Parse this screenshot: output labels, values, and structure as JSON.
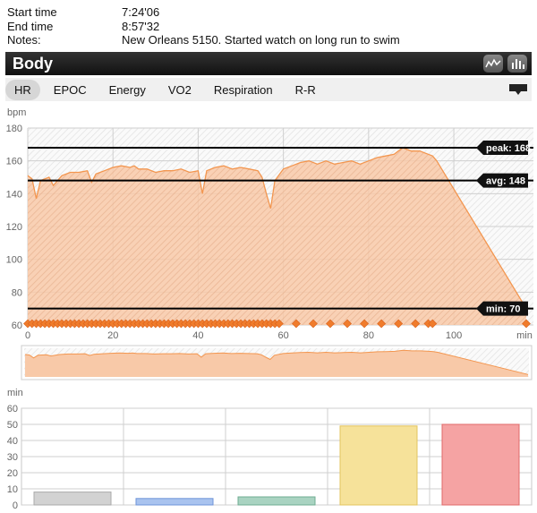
{
  "info": [
    {
      "label": "Start time",
      "value": "7:24'06"
    },
    {
      "label": "End time",
      "value": "8:57'32"
    },
    {
      "label": "Notes:",
      "value": "New Orleans 5150. Started watch on long run to swim"
    }
  ],
  "panel": {
    "title": "Body"
  },
  "tabs": [
    "HR",
    "EPOC",
    "Energy",
    "VO2",
    "Respiration",
    "R-R"
  ],
  "active_tab": "HR",
  "colors": {
    "hr_fill": "#f8c9a8",
    "hr_line": "#f3964f",
    "marker": "#f07c2c",
    "bar_gray": "#d2d2d2",
    "bar_blue": "#a9c3ef",
    "bar_green": "#a9d3c1",
    "bar_yellow": "#f6e29a",
    "bar_red": "#f5a3a3"
  },
  "icons": [
    "waveform-icon",
    "bars-icon",
    "dropdown-menu-icon"
  ],
  "chart_data": [
    {
      "type": "area",
      "ylabel": "bpm",
      "xlabel_unit": "min",
      "ylim": [
        60,
        180
      ],
      "xlim": [
        0,
        117
      ],
      "y_ticks": [
        "60",
        "80",
        "100",
        "120",
        "140",
        "160",
        "180"
      ],
      "x_ticks": [
        "0",
        "20",
        "40",
        "60",
        "80",
        "100"
      ],
      "x_unit_label": "min",
      "references": [
        {
          "label": "peak: 168",
          "value": 168
        },
        {
          "label": "avg: 148",
          "value": 148
        },
        {
          "label": "min: 70",
          "value": 70
        }
      ],
      "x": [
        0,
        1,
        2,
        3,
        5,
        6,
        8,
        10,
        12,
        14,
        15,
        16,
        18,
        20,
        22,
        24,
        25,
        26,
        28,
        30,
        32,
        34,
        36,
        38,
        40,
        41,
        42,
        44,
        46,
        48,
        50,
        52,
        54,
        55,
        56,
        57,
        58,
        60,
        62,
        64,
        66,
        68,
        70,
        72,
        74,
        76,
        78,
        80,
        82,
        84,
        86,
        88,
        90,
        92,
        94,
        95,
        96,
        117
      ],
      "values": [
        151,
        149,
        137,
        148,
        150,
        145,
        151,
        153,
        153,
        154,
        147,
        152,
        154,
        156,
        157,
        156,
        157,
        155,
        155,
        153,
        154,
        154,
        155,
        153,
        154,
        140,
        154,
        156,
        157,
        155,
        156,
        155,
        154,
        150,
        140,
        131,
        148,
        155,
        157,
        159,
        160,
        158,
        160,
        158,
        159,
        160,
        158,
        160,
        162,
        163,
        164,
        168,
        166,
        166,
        164,
        163,
        160,
        70
      ],
      "markers_x": [
        0,
        1,
        2,
        3,
        4,
        5,
        6,
        7,
        8,
        9,
        10,
        11,
        12,
        13,
        14,
        15,
        16,
        17,
        18,
        19,
        20,
        21,
        22,
        23,
        24,
        25,
        26,
        27,
        28,
        29,
        30,
        31,
        32,
        33,
        34,
        35,
        36,
        37,
        38,
        39,
        40,
        41,
        42,
        43,
        44,
        45,
        46,
        47,
        48,
        49,
        50,
        51,
        52,
        53,
        54,
        55,
        56,
        57,
        58,
        59,
        63,
        67,
        71,
        75,
        79,
        83,
        87,
        91,
        94,
        95,
        117
      ]
    },
    {
      "type": "bar",
      "ylabel": "min",
      "ylim": [
        0,
        60
      ],
      "y_ticks": [
        "0",
        "10",
        "20",
        "30",
        "40",
        "50",
        "60"
      ],
      "values": [
        8,
        4,
        5,
        49,
        50
      ],
      "colors": [
        "#d2d2d2",
        "#a9c3ef",
        "#a9d3c1",
        "#f6e29a",
        "#f5a3a3"
      ]
    }
  ]
}
